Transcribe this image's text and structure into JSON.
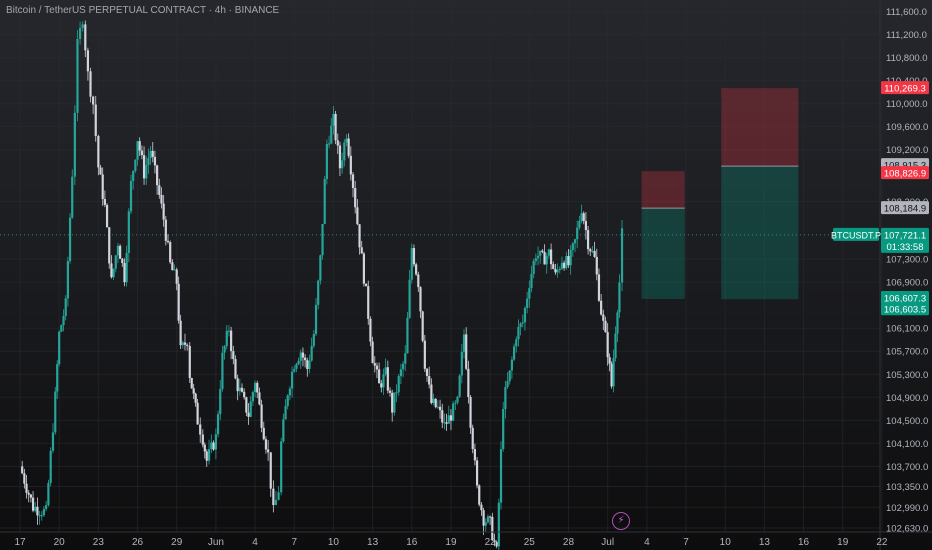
{
  "header": {
    "title": "Bitcoin / TetherUS PERPETUAL CONTRACT · 4h · BINANCE"
  },
  "icons": {
    "bolt": "⚡"
  },
  "colors": {
    "background": "#1c1d21",
    "bull": "#26a69a",
    "bear": "#d1d4dc",
    "stop_zone": "#f23645",
    "profit_zone": "#089981",
    "grid": "#2a2c31",
    "axis_text": "#b2b5be"
  },
  "chart_data": {
    "type": "candlestick",
    "title": "Bitcoin / TetherUS PERPETUAL CONTRACT · 4h · BINANCE",
    "symbol": "BTCUSDT.P",
    "interval": "4h",
    "exchange": "BINANCE",
    "x_ticks": [
      "17",
      "20",
      "23",
      "26",
      "29",
      "Jun",
      "4",
      "7",
      "10",
      "13",
      "16",
      "19",
      "22",
      "25",
      "28",
      "Jul",
      "4",
      "7",
      "10",
      "13",
      "16",
      "19",
      "22"
    ],
    "y_ticks": [
      111600,
      111200,
      110800,
      110400,
      110000,
      109600,
      109200,
      108300,
      107300,
      106900,
      106100,
      105700,
      105300,
      104900,
      104500,
      104100,
      103700,
      103350,
      102990,
      102630
    ],
    "y_tick_labels": [
      "111,600.0",
      "111,200.0",
      "110,800.0",
      "110,400.0",
      "110,000.0",
      "109,600.0",
      "109,200.0",
      "108,300.0",
      "107,300.0",
      "106,900.0",
      "106,100.0",
      "105,700.0",
      "105,300.0",
      "104,900.0",
      "104,500.0",
      "104,100.0",
      "103,700.0",
      "103,350.0",
      "102,990.0",
      "102,630.0"
    ],
    "ylim": [
      102630,
      111800
    ],
    "close_path": [
      [
        "17",
        103700
      ],
      [
        "18",
        103000
      ],
      [
        "19",
        102900
      ],
      [
        "19.7",
        104900
      ],
      [
        "20",
        106000
      ],
      [
        "20.5",
        106500
      ],
      [
        "21",
        108800
      ],
      [
        "21.4",
        111000
      ],
      [
        "21.8",
        111500
      ],
      [
        "22.2",
        110500
      ],
      [
        "22.6",
        110000
      ],
      [
        "23",
        108900
      ],
      [
        "23.5",
        108200
      ],
      [
        "24",
        106900
      ],
      [
        "24.5",
        107600
      ],
      [
        "25",
        107000
      ],
      [
        "25.5",
        108600
      ],
      [
        "26",
        109400
      ],
      [
        "26.5",
        108800
      ],
      [
        "27",
        109200
      ],
      [
        "27.5",
        108600
      ],
      [
        "28",
        108000
      ],
      [
        "28.5",
        107200
      ],
      [
        "29",
        106900
      ],
      [
        "29.3",
        105700
      ],
      [
        "29.8",
        105900
      ],
      [
        "30",
        105300
      ],
      [
        "30.6",
        104500
      ],
      [
        "31",
        104200
      ],
      [
        "31.3",
        103800
      ],
      [
        "Jun",
        104200
      ],
      [
        "1.5",
        105600
      ],
      [
        "2",
        106100
      ],
      [
        "2.5",
        105200
      ],
      [
        "3",
        104900
      ],
      [
        "3.5",
        104600
      ],
      [
        "4",
        105200
      ],
      [
        "4.5",
        104500
      ],
      [
        "5",
        103900
      ],
      [
        "5.4",
        102900
      ],
      [
        "5.8",
        103300
      ],
      [
        "6",
        104100
      ],
      [
        "6.5",
        105000
      ],
      [
        "7",
        105500
      ],
      [
        "7.5",
        105700
      ],
      [
        "8",
        105400
      ],
      [
        "8.5",
        106000
      ],
      [
        "9",
        107300
      ],
      [
        "9.5",
        109300
      ],
      [
        "10",
        109700
      ],
      [
        "10.5",
        108900
      ],
      [
        "11",
        109500
      ],
      [
        "11.5",
        108600
      ],
      [
        "12",
        107600
      ],
      [
        "12.5",
        106700
      ],
      [
        "13",
        105600
      ],
      [
        "13.5",
        105100
      ],
      [
        "14",
        105300
      ],
      [
        "14.5",
        104700
      ],
      [
        "15",
        105200
      ],
      [
        "15.5",
        105600
      ],
      [
        "16",
        107500
      ],
      [
        "16.5",
        106900
      ],
      [
        "17",
        105500
      ],
      [
        "17.5",
        104800
      ],
      [
        "18",
        104700
      ],
      [
        "18.5",
        104400
      ],
      [
        "19",
        104600
      ],
      [
        "19.5",
        104800
      ],
      [
        "20",
        106000
      ],
      [
        "20.5",
        104500
      ],
      [
        "21",
        103300
      ],
      [
        "21.5",
        102800
      ],
      [
        "22",
        102700
      ],
      [
        "22.5",
        102200
      ],
      [
        "23",
        104800
      ],
      [
        "23.5",
        105300
      ],
      [
        "24",
        106000
      ],
      [
        "24.5",
        106200
      ],
      [
        "25",
        106900
      ],
      [
        "25.5",
        107400
      ],
      [
        "26",
        107300
      ],
      [
        "26.5",
        107400
      ],
      [
        "27",
        107000
      ],
      [
        "27.5",
        107300
      ],
      [
        "28",
        107200
      ],
      [
        "28.5",
        107600
      ],
      [
        "29",
        108200
      ],
      [
        "29.5",
        107600
      ],
      [
        "30",
        107300
      ],
      [
        "30.5",
        106400
      ],
      [
        "Jul",
        105700
      ],
      [
        "1.3",
        105100
      ],
      [
        "1.6",
        106100
      ],
      [
        "1.9",
        106900
      ],
      [
        "2.1",
        107721
      ]
    ],
    "last_price": {
      "symbol": "BTCUSDT.P",
      "value": 107721.1,
      "label": "107,721.1",
      "countdown": "01:33:58"
    },
    "positions": [
      {
        "name": "short-position-1",
        "stop": 108826.9,
        "entry": 108184.9,
        "target": 106607.3,
        "stop_label": "108,826.9",
        "entry_label": "108,184.9",
        "target_label": "106,607.3",
        "start_x": "3.6",
        "end_x": "6.9"
      },
      {
        "name": "short-position-2",
        "stop": 110269.3,
        "entry": 108915.3,
        "target": 106603.5,
        "stop_label": "110,269.3",
        "entry_label": "108,915.3",
        "target_label": "106,603.5",
        "start_x": "9.7",
        "end_x": "15.6"
      }
    ],
    "grid": true,
    "legend": "none"
  }
}
